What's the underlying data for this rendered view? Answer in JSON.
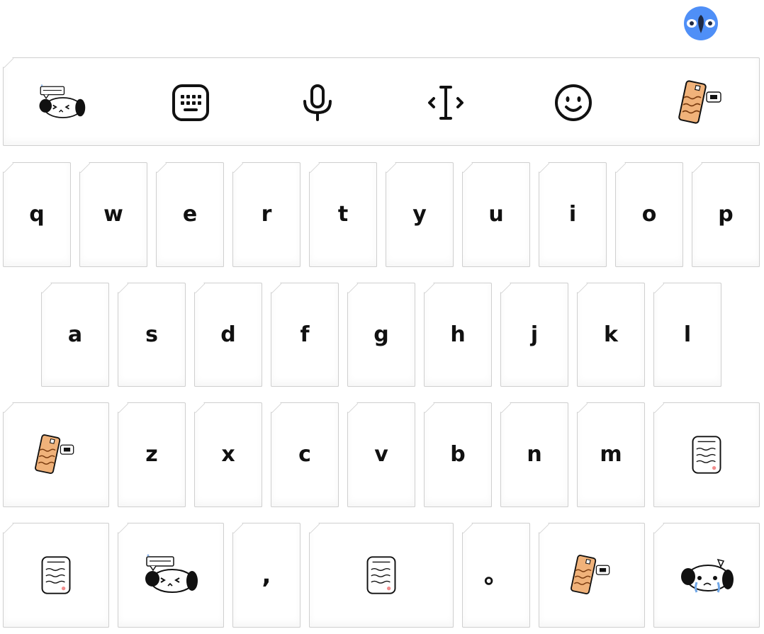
{
  "app": {
    "logo_icon": "parrot-mascot-icon"
  },
  "toolbar": {
    "items": [
      {
        "name": "sticker-dog-speech-bubble",
        "icon": "dog-speech-sticker"
      },
      {
        "name": "keyboard",
        "icon": "keyboard-icon"
      },
      {
        "name": "voice-input",
        "icon": "microphone-icon"
      },
      {
        "name": "cursor-move",
        "icon": "text-cursor-arrows-icon"
      },
      {
        "name": "emoji",
        "icon": "smiley-icon"
      },
      {
        "name": "sticker-phone",
        "icon": "phone-sticker"
      }
    ]
  },
  "keys": {
    "row1": [
      "q",
      "w",
      "e",
      "r",
      "t",
      "y",
      "u",
      "i",
      "o",
      "p"
    ],
    "row2": [
      "a",
      "s",
      "d",
      "f",
      "g",
      "h",
      "j",
      "k",
      "l"
    ],
    "row3": [
      "z",
      "x",
      "c",
      "v",
      "b",
      "n",
      "m"
    ],
    "comma": ",",
    "period": "。"
  },
  "row3_specials": {
    "left_icon": "phone-sticker",
    "right_icon": "essay-paper-sticker"
  },
  "row4_specials": {
    "symbols_icon": "essay-paper-sticker",
    "numbers_icon": "dog-speech-sticker",
    "space_icon": "essay-paper-sticker",
    "language_icon": "phone-sticker",
    "enter_icon": "crying-dog-sticker"
  },
  "colors": {
    "key_border": "#cfcfcf",
    "key_bg": "#ffffff",
    "glyph": "#111111",
    "phone_orange": "#f0b27a",
    "logo_blue": "#4f8ff7"
  }
}
